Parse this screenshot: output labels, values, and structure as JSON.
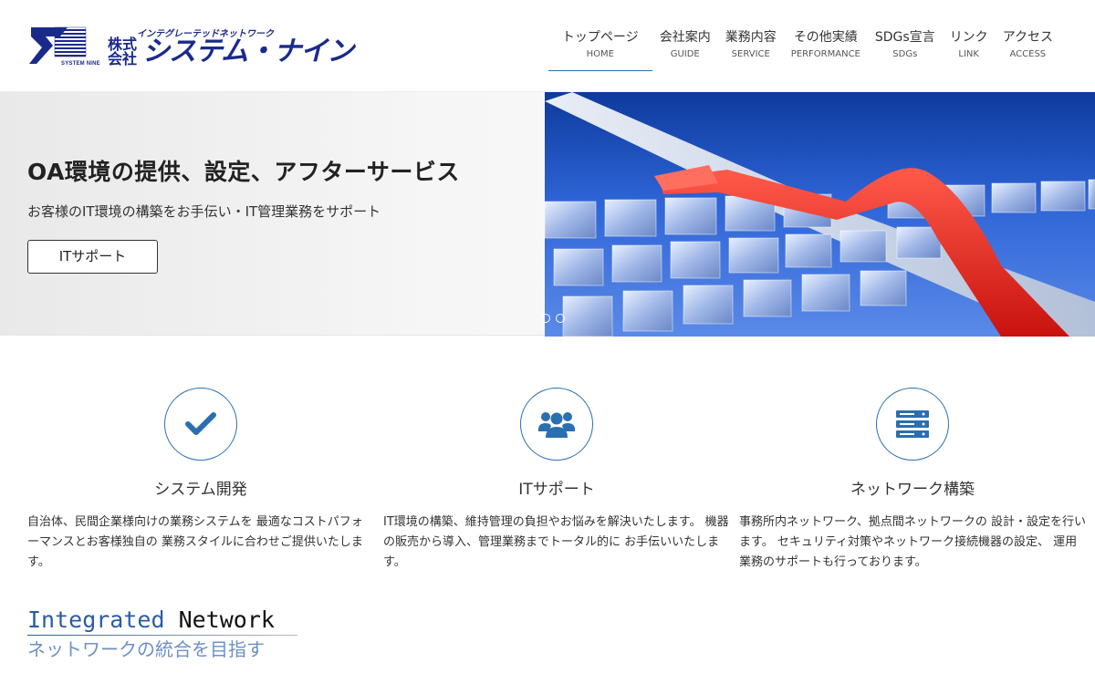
{
  "header": {
    "logo": {
      "tagline": "インテグレーテッドネットワーク",
      "kabushiki": "株式会社",
      "name": "システム・ナイン",
      "mark_text": "SYSTEM NINE"
    },
    "nav": [
      {
        "jp": "トップページ",
        "en": "HOME",
        "active": true
      },
      {
        "jp": "会社案内",
        "en": "GUIDE"
      },
      {
        "jp": "業務内容",
        "en": "SERVICE"
      },
      {
        "jp": "その他実績",
        "en": "PERFORMANCE"
      },
      {
        "jp": "SDGs宣言",
        "en": "SDGs"
      },
      {
        "jp": "リンク",
        "en": "LINK"
      },
      {
        "jp": "アクセス",
        "en": "ACCESS"
      }
    ]
  },
  "hero": {
    "title": "OA環境の提供、設定、アフターサービス",
    "subtitle": "お客様のIT環境の構築をお手伝い・IT管理業務をサポート",
    "button_label": "ITサポート",
    "slide_count": 2,
    "active_slide": 1
  },
  "services": [
    {
      "icon": "check-icon",
      "title": "システム開発",
      "text": "自治体、民間企業様向けの業務システムを 最適なコストパフォーマンスとお客様独自の 業務スタイルに合わせご提供いたします。"
    },
    {
      "icon": "users-icon",
      "title": "ITサポート",
      "text": "IT環境の構築、維持管理の負担やお悩みを解決いたします。 機器の販売から導入、管理業務までトータル的に お手伝いいたします。"
    },
    {
      "icon": "server-icon",
      "title": "ネットワーク構築",
      "text": "事務所内ネットワーク、拠点間ネットワークの 設計・設定を行います。 セキュリティ対策やネットワーク接続機器の設定、 運用業務のサポートも行っております。"
    }
  ],
  "integrated": {
    "en_part1": "Integrated",
    "en_part2": "Network",
    "jp": "ネットワークの統合を目指す"
  },
  "colors": {
    "brand_navy": "#1a2a8a",
    "accent_blue": "#2a6fb0",
    "hero_arrow_red": "#e8231f"
  }
}
